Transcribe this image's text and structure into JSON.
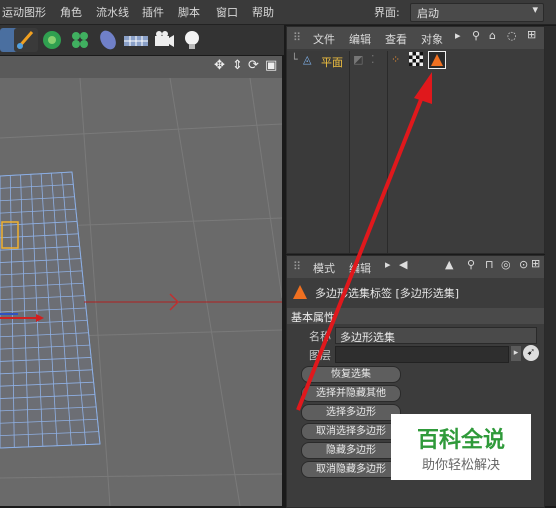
{
  "menubar": {
    "items": [
      "运动图形",
      "角色",
      "流水线",
      "插件",
      "脚本",
      "窗口",
      "帮助"
    ],
    "layout_label": "界面:",
    "layout_value": "启动"
  },
  "object_manager": {
    "menu": [
      "文件",
      "编辑",
      "查看",
      "对象"
    ],
    "object_name": "平面"
  },
  "attribute_manager": {
    "menu": [
      "模式",
      "编辑"
    ],
    "tag_title": "多边形选集标签 [多边形选集]",
    "section": "基本属性",
    "name_label": "名称",
    "name_value": "多边形选集",
    "layer_label": "图层",
    "buttons": [
      "恢复选集",
      "选择并隐藏其他",
      "选择多边形",
      "取消选择多边形",
      "隐藏多边形",
      "取消隐藏多边形"
    ]
  },
  "watermark": {
    "title": "百科全说",
    "subtitle": "助你轻松解决"
  },
  "colors": {
    "accent": "#e8a030",
    "arrow": "#e0181c",
    "mesh": "#7fa6e0"
  }
}
